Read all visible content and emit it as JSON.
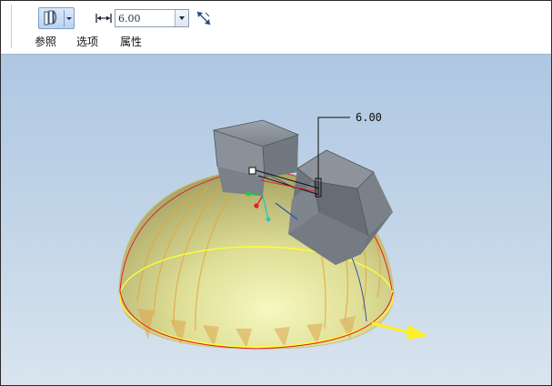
{
  "dashboard": {
    "tabs": [
      {
        "label": "参照"
      },
      {
        "label": "选项"
      },
      {
        "label": "属性"
      }
    ],
    "depth_value": "6.00",
    "icons": {
      "type_button": "extrude-to-surface-icon",
      "dropdown": "chevron-down-icon",
      "dimension": "dimension-arrows-icon",
      "flip": "flip-direction-icon"
    }
  },
  "viewport": {
    "dimension_label": "6.00",
    "colors": {
      "background_top": "#aec7e2",
      "background_bottom": "#d9e4ee",
      "dome": "#d9d98a",
      "prism": "#7d848c",
      "preview_edge": "#e0202a",
      "direction_arrow": "#ffee22"
    }
  }
}
